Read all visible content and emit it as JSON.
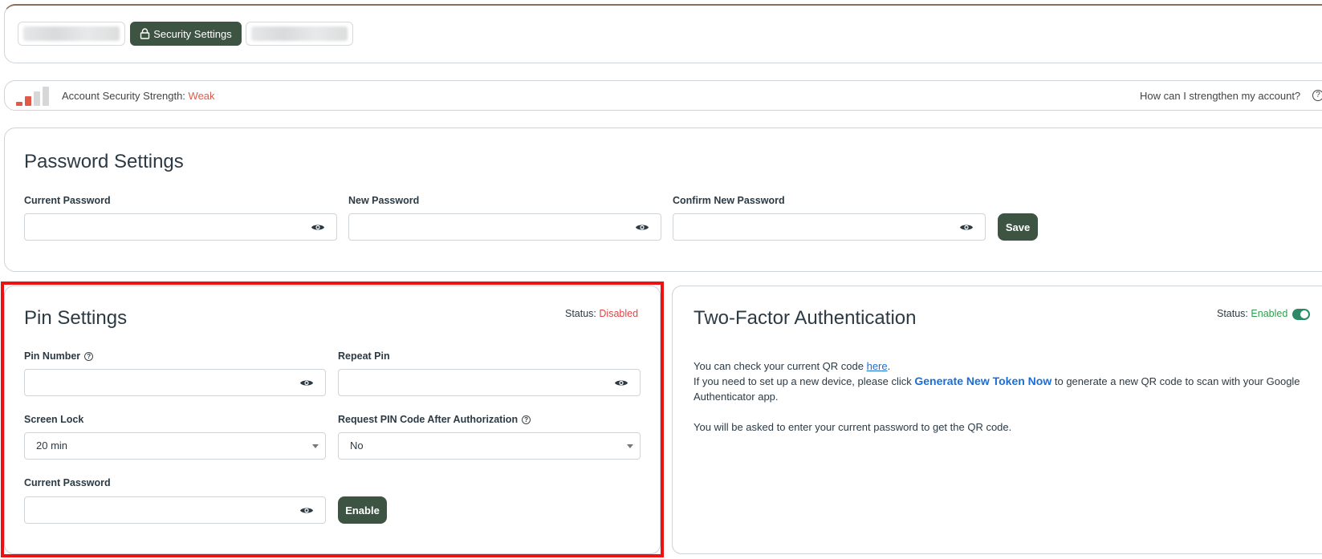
{
  "tabs": {
    "items": [
      {
        "label": "",
        "blurred": true,
        "active": false
      },
      {
        "label": "Security Settings",
        "icon": "lock-icon",
        "active": true
      },
      {
        "label": "",
        "blurred": true,
        "active": false
      }
    ]
  },
  "strength": {
    "label": "Account Security Strength:",
    "level": "Weak",
    "level_color": "#e05a4a",
    "bars_filled": 2,
    "bars_total": 4,
    "help_text": "How can I strengthen my account?",
    "help_icon": "question-circle-icon"
  },
  "password_settings": {
    "title": "Password Settings",
    "current_label": "Current Password",
    "new_label": "New Password",
    "confirm_label": "Confirm New Password",
    "current_value": "",
    "new_value": "",
    "confirm_value": "",
    "save_label": "Save"
  },
  "pin_settings": {
    "title": "Pin Settings",
    "status_label": "Status:",
    "status_value": "Disabled",
    "pin_label": "Pin Number",
    "repeat_label": "Repeat Pin",
    "screen_lock_label": "Screen Lock",
    "screen_lock_value": "20 min",
    "request_pin_label": "Request PIN Code After Authorization",
    "request_pin_value": "No",
    "current_password_label": "Current Password",
    "enable_label": "Enable",
    "highlight_color": "#ee1111"
  },
  "two_factor": {
    "title": "Two-Factor Authentication",
    "status_label": "Status:",
    "status_value": "Enabled",
    "toggle_on": true,
    "line1_pre": "You can check your current QR code ",
    "line1_link": "here",
    "line1_post": ".",
    "line2_pre": "If you need to set up a new device, please click ",
    "line2_bold": "Generate New Token Now",
    "line2_post": " to generate a new QR code to scan with your Google Authenticator app.",
    "line3": "You will be asked to enter your current password to get the QR code."
  },
  "colors": {
    "primary": "#3e5443",
    "weak": "#e05a4a",
    "disabled": "#e04545",
    "enabled": "#2e9e4e",
    "link": "#1a6ed8"
  }
}
